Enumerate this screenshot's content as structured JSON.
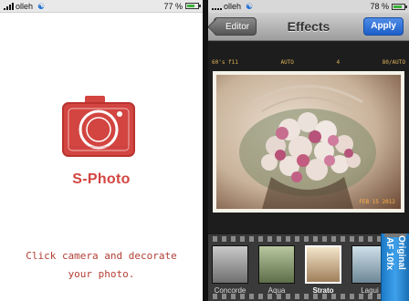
{
  "left_screen": {
    "status": {
      "carrier": "olleh",
      "battery": "77 %",
      "battery_level": 0.77
    },
    "app_name": "S-Photo",
    "hint_line1": "Click camera and decorate",
    "hint_line2": "your photo.",
    "colors": {
      "brand": "#d24541"
    }
  },
  "right_screen": {
    "status": {
      "carrier": "olleh",
      "battery": "78 %",
      "battery_level": 0.78
    },
    "nav": {
      "back_label": "Editor",
      "title": "Effects",
      "apply_label": "Apply"
    },
    "film_text": {
      "left": "60's f11",
      "mid": "AUTO",
      "right": "4",
      "far_right": "80/AUTO"
    },
    "date_stamp": "FEB 15 2012",
    "filters": [
      {
        "label": "Concorde",
        "selected": false
      },
      {
        "label": "Aqua",
        "selected": false
      },
      {
        "label": "Strato",
        "selected": true
      },
      {
        "label": "Lagui",
        "selected": false
      }
    ],
    "cartridge": {
      "label": "Original",
      "badge1": "AF",
      "badge2": "10fx"
    },
    "colors": {
      "apply": "#1d5fc8",
      "cartridge": "#1b7ac7"
    }
  }
}
